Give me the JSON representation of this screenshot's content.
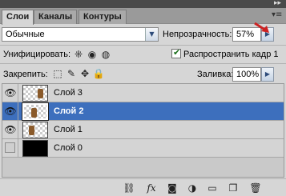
{
  "tabs": [
    {
      "label": "Слои",
      "active": true
    },
    {
      "label": "Каналы",
      "active": false
    },
    {
      "label": "Контуры",
      "active": false
    }
  ],
  "blend_mode": {
    "value": "Обычные"
  },
  "opacity": {
    "label": "Непрозрачность:",
    "value": "57%"
  },
  "unify": {
    "label": "Унифицировать:"
  },
  "propagate": {
    "label": "Распространить кадр 1",
    "checked": true
  },
  "lock": {
    "label": "Закрепить:"
  },
  "fill": {
    "label": "Заливка:",
    "value": "100%"
  },
  "layers": [
    {
      "name": "Слой 3",
      "visible": true,
      "selected": false
    },
    {
      "name": "Слой 2",
      "visible": true,
      "selected": true
    },
    {
      "name": "Слой 1",
      "visible": true,
      "selected": false
    },
    {
      "name": "Слой 0",
      "visible": false,
      "selected": false
    }
  ],
  "colors": {
    "selection": "#3d6fbd",
    "annotation_arrow": "#cc2222"
  },
  "icons": {
    "menu": "panel-menu-icon",
    "unify": [
      "unify-position-icon",
      "unify-visibility-icon",
      "unify-style-icon"
    ],
    "lock": [
      "lock-transparent-icon",
      "lock-image-icon",
      "lock-position-icon",
      "lock-all-icon"
    ],
    "bottom": [
      "link-layers-icon",
      "layer-style-icon",
      "layer-mask-icon",
      "adjustment-layer-icon",
      "new-group-icon",
      "new-layer-icon",
      "delete-layer-icon"
    ]
  }
}
